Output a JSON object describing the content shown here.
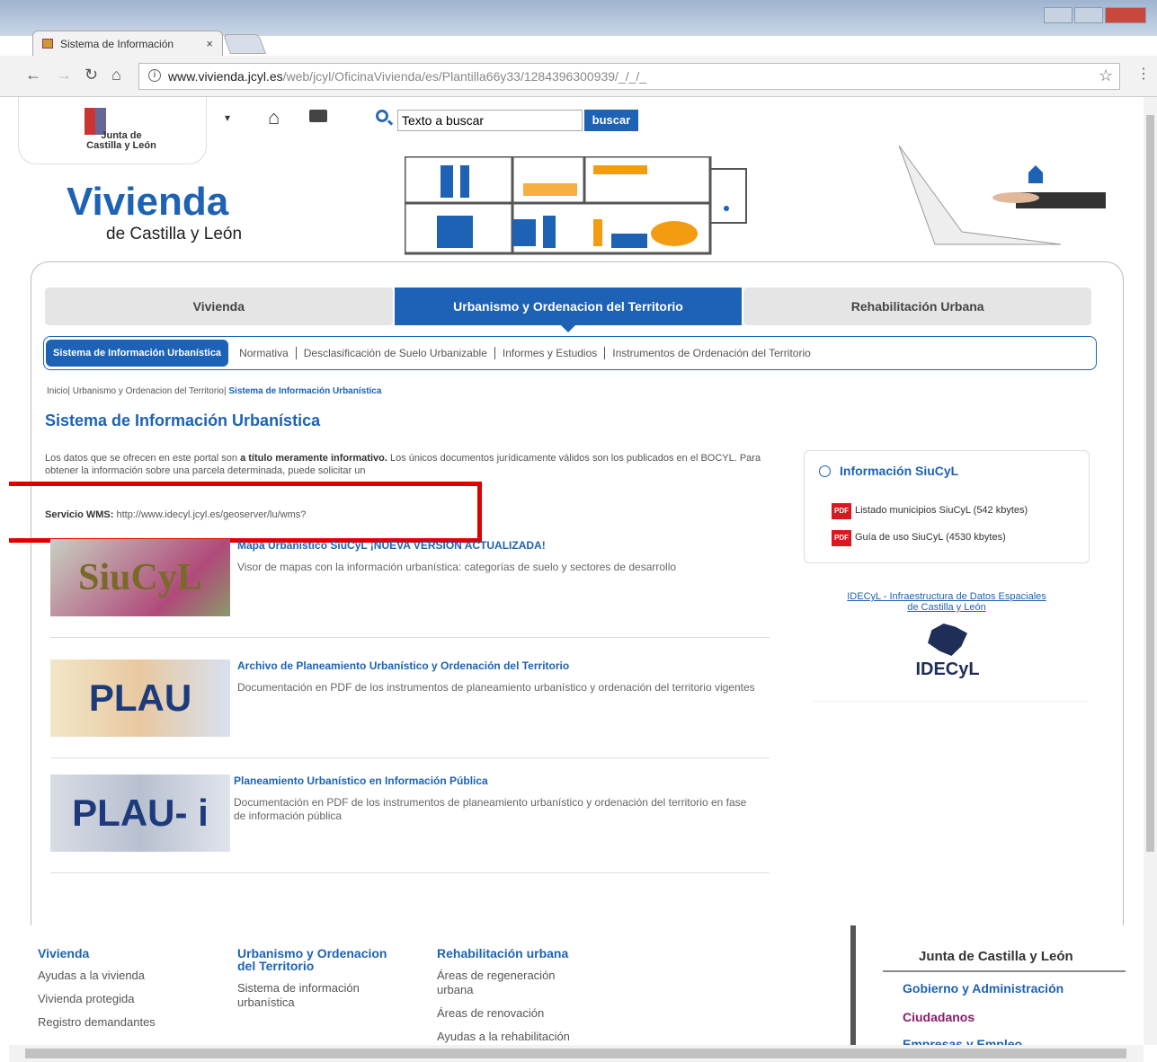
{
  "browser": {
    "tab_title": "Sistema de Información",
    "tab_close": "×",
    "url_host": "www.vivienda.jcyl.es",
    "url_path": "/web/jcyl/OficinaVivienda/es/Plantilla66y33/1284396300939/_/_/_"
  },
  "header": {
    "logo_text_line1": "Junta de",
    "logo_text_line2": "Castilla y León",
    "search_placeholder": "Texto a buscar",
    "search_button": "buscar",
    "brand_title": "Vivienda",
    "brand_subtitle": "de Castilla y León"
  },
  "main_tabs": [
    {
      "label": "Vivienda"
    },
    {
      "label": "Urbanismo y Ordenacion del Territorio"
    },
    {
      "label": "Rehabilitación Urbana"
    }
  ],
  "sub_nav": [
    {
      "label": "Sistema de Información Urbanística"
    },
    {
      "label": "Normativa"
    },
    {
      "label": "Desclasificación de Suelo Urbanizable"
    },
    {
      "label": "Informes y Estudios"
    },
    {
      "label": "Instrumentos de Ordenación del Territorio"
    }
  ],
  "breadcrumb": {
    "home": "Inicio",
    "section": "Urbanismo y Ordenacion del Territorio",
    "current": "Sistema de Información Urbanística"
  },
  "page_title": "Sistema de Información Urbanística",
  "intro": {
    "before": "Los datos que se ofrecen en este portal son ",
    "bold": "a título meramente informativo.",
    "after": " Los únicos documentos jurídicamente válidos son los publicados en el BOCYL. Para obtener la información sobre una parcela determinada, puede solicitar un"
  },
  "wms": {
    "label": "Servicio WMS:",
    "url": "http://www.idecyl.jcyl.es/geoserver/lu/wms?"
  },
  "items": [
    {
      "thumb": "SiuCyL",
      "title": "Mapa Urbanístico SiuCyL ¡NUEVA VERSIÓN ACTUALIZADA!",
      "desc": "Visor de mapas con la información urbanística: categorías de suelo y sectores de desarrollo"
    },
    {
      "thumb": "PLAU",
      "title": "Archivo de Planeamiento Urbanístico y Ordenación del Territorio",
      "desc": "Documentación en PDF de los instrumentos de planeamiento urbanístico y ordenación del territorio vigentes"
    },
    {
      "thumb": "PLAU- i",
      "title": "Planeamiento Urbanístico en Información Pública",
      "desc": "Documentación en PDF de los instrumentos de planeamiento urbanístico y ordenación del territorio en fase de información pública"
    }
  ],
  "sidebar": {
    "heading": "Información SiuCyL",
    "pdf_badge": "PDF",
    "docs": [
      {
        "label": "Listado municipios SiuCyL (542 kbytes)"
      },
      {
        "label": "Guía de uso SiuCyL (4530 kbytes)"
      }
    ],
    "idecyl_link": "IDECyL - Infraestructura de Datos Espaciales de Castilla y León",
    "idecyl_logo": "IDECyL"
  },
  "footer": {
    "col1": {
      "heading": "Vivienda",
      "links": [
        "Ayudas a la vivienda",
        "Vivienda protegida",
        "Registro demandantes"
      ]
    },
    "col2": {
      "heading": "Urbanismo y Ordenacion del Territorio",
      "links": [
        "Sistema de información urbanística"
      ]
    },
    "col3": {
      "heading": "Rehabilitación urbana",
      "links": [
        "Áreas de regeneración urbana",
        "Áreas de renovación",
        "Ayudas a la rehabilitación"
      ]
    },
    "junta": {
      "heading": "Junta de Castilla y León",
      "link1": "Gobierno y Administración",
      "link2": "Ciudadanos",
      "link3": "Empresas y Empleo"
    }
  },
  "colors": {
    "accent": "#1d62b4",
    "highlight": "#e00000"
  }
}
